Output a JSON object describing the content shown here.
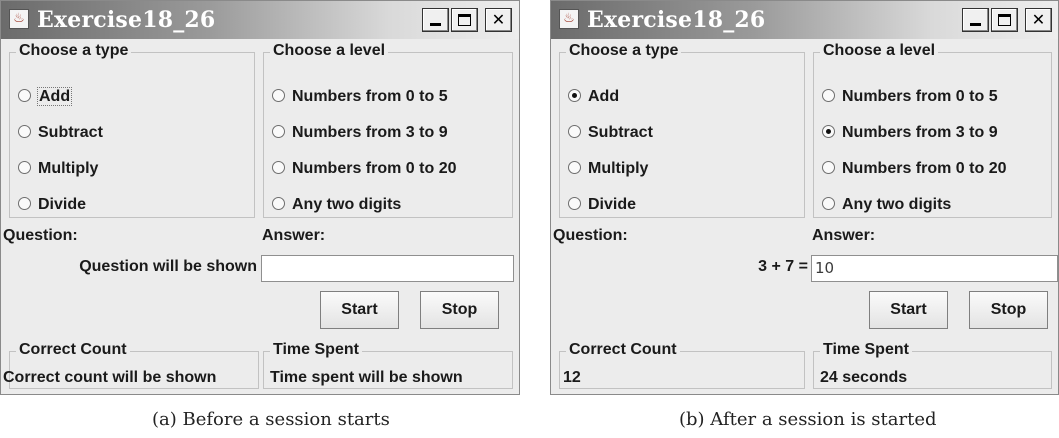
{
  "windows": [
    {
      "title": "Exercise18_26",
      "type_panel": {
        "title": "Choose a type",
        "options": [
          {
            "label": "Add",
            "selected": false
          },
          {
            "label": "Subtract",
            "selected": false
          },
          {
            "label": "Multiply",
            "selected": false
          },
          {
            "label": "Divide",
            "selected": false
          }
        ]
      },
      "level_panel": {
        "title": "Choose a level",
        "options": [
          {
            "label": "Numbers from 0 to 5",
            "selected": false
          },
          {
            "label": "Numbers from 3 to 9",
            "selected": false
          },
          {
            "label": "Numbers from 0 to 20",
            "selected": false
          },
          {
            "label": "Any two digits",
            "selected": false
          }
        ]
      },
      "question_label": "Question:",
      "answer_label": "Answer:",
      "question_text": "Question will be shown",
      "answer_value": "",
      "start_label": "Start",
      "stop_label": "Stop",
      "correct_panel": {
        "title": "Correct Count",
        "value": "Correct count will be shown"
      },
      "time_panel": {
        "title": "Time Spent",
        "value": "Time spent will be shown"
      }
    },
    {
      "title": "Exercise18_26",
      "type_panel": {
        "title": "Choose a type",
        "options": [
          {
            "label": "Add",
            "selected": true
          },
          {
            "label": "Subtract",
            "selected": false
          },
          {
            "label": "Multiply",
            "selected": false
          },
          {
            "label": "Divide",
            "selected": false
          }
        ]
      },
      "level_panel": {
        "title": "Choose a level",
        "options": [
          {
            "label": "Numbers from 0 to 5",
            "selected": false
          },
          {
            "label": "Numbers from 3 to 9",
            "selected": true
          },
          {
            "label": "Numbers from 0 to 20",
            "selected": false
          },
          {
            "label": "Any two digits",
            "selected": false
          }
        ]
      },
      "question_label": "Question:",
      "answer_label": "Answer:",
      "question_text": "3 + 7 =",
      "answer_value": "10",
      "start_label": "Start",
      "stop_label": "Stop",
      "correct_panel": {
        "title": "Correct Count",
        "value": "12"
      },
      "time_panel": {
        "title": "Time Spent",
        "value": "24 seconds"
      }
    }
  ],
  "captions": [
    "(a) Before a session starts",
    "(b) After a session is started"
  ],
  "icons": {
    "app": "java-cup-icon",
    "minimize": "minimize-icon",
    "maximize": "maximize-icon",
    "close": "close-icon"
  }
}
